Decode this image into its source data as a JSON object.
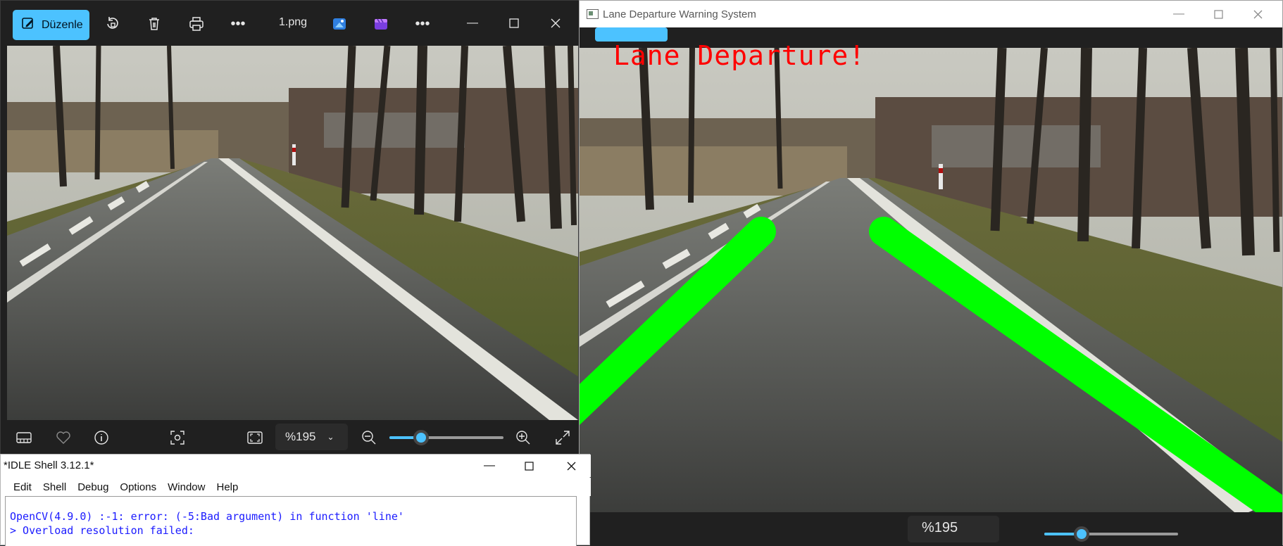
{
  "photos_app": {
    "edit_label": "Düzenle",
    "filename": "1.png",
    "zoom_level": "%195",
    "zoom_slider_value": 0.28,
    "toolbar_icons": [
      "edit-icon",
      "rotate-icon",
      "delete-icon",
      "print-icon",
      "more-icon",
      "image-editor-icon",
      "clipchamp-icon",
      "more-icon"
    ],
    "bottom_icons": [
      "filmstrip-icon",
      "favorite-icon",
      "info-icon",
      "visual-search-icon",
      "fit-window-icon",
      "zoom-out-icon",
      "zoom-in-icon",
      "fullscreen-icon"
    ]
  },
  "opencv_window": {
    "title": "Lane Departure Warning System",
    "overlay_text": "Lane  Departure!",
    "overlay_color": "#ff0000",
    "lane_line_color": "#00ff00",
    "zoom_level": "%195",
    "zoom_slider_value": 0.28
  },
  "idle_shell": {
    "title": "*IDLE Shell 3.12.1*",
    "menu": [
      "Edit",
      "Shell",
      "Debug",
      "Options",
      "Window",
      "Help"
    ],
    "lines": [
      "OpenCV(4.9.0) :-1: error: (-5:Bad argument) in function 'line'",
      "> Overload resolution failed:"
    ],
    "text_color": "#1a1aff"
  },
  "colors": {
    "accent": "#4cc2ff",
    "dark_chrome": "#202020"
  }
}
